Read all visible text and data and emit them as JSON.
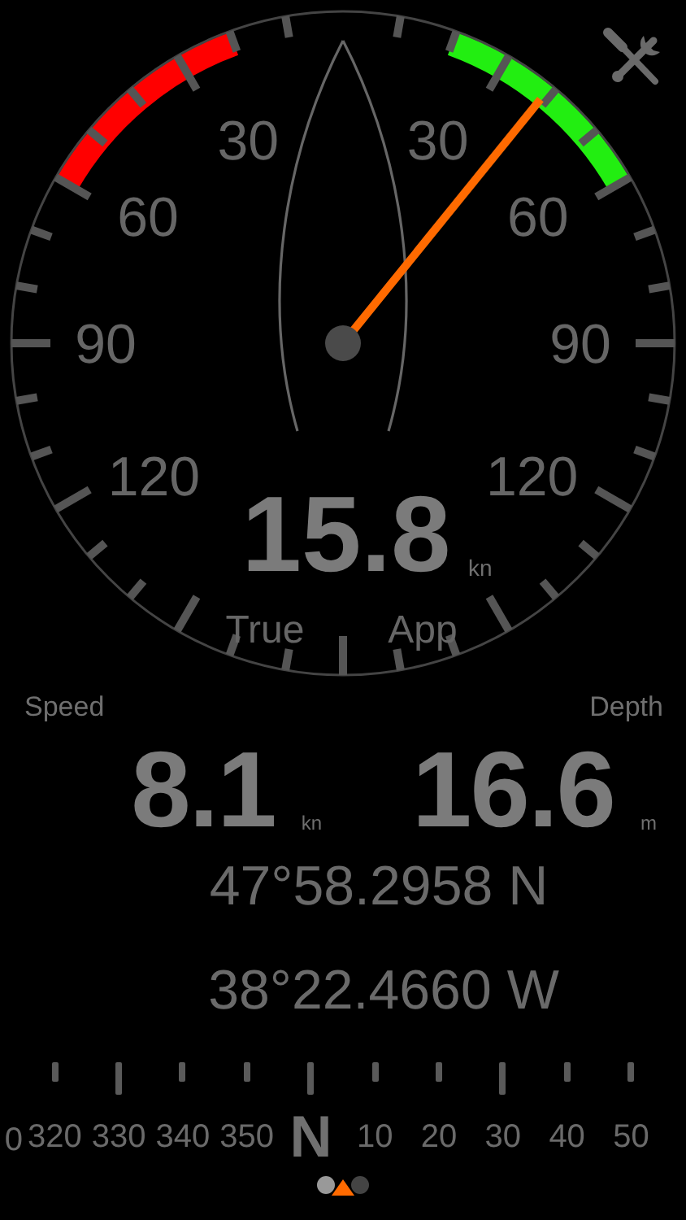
{
  "gauge": {
    "port_labels": [
      "30",
      "60",
      "90",
      "120"
    ],
    "starboard_labels": [
      "30",
      "60",
      "90",
      "120"
    ],
    "zones": [
      {
        "kind": "port",
        "color": "#ff0000"
      },
      {
        "kind": "starboard",
        "color": "#22ee11"
      }
    ],
    "speed": "15.8",
    "unit": "kn",
    "modes": [
      "True",
      "App"
    ]
  },
  "readouts": [
    {
      "label": "Speed",
      "value": "8.1",
      "unit": "kn"
    },
    {
      "label": "Depth",
      "value": "16.6",
      "unit": "m"
    }
  ],
  "position": {
    "latitude": "47°58.2958 N",
    "longitude": "38°22.4660 W"
  },
  "compass": {
    "labels": [
      {
        "text": "0",
        "kind": "edge"
      },
      {
        "text": "320",
        "kind": "degree"
      },
      {
        "text": "330",
        "kind": "degree"
      },
      {
        "text": "340",
        "kind": "degree"
      },
      {
        "text": "350",
        "kind": "degree"
      },
      {
        "text": "N",
        "kind": "cardinal"
      },
      {
        "text": "10",
        "kind": "degree"
      },
      {
        "text": "20",
        "kind": "degree"
      },
      {
        "text": "30",
        "kind": "degree"
      },
      {
        "text": "40",
        "kind": "degree"
      },
      {
        "text": "50",
        "kind": "degree"
      }
    ]
  },
  "pages": [
    {
      "selected": true
    },
    {
      "selected": false
    }
  ]
}
